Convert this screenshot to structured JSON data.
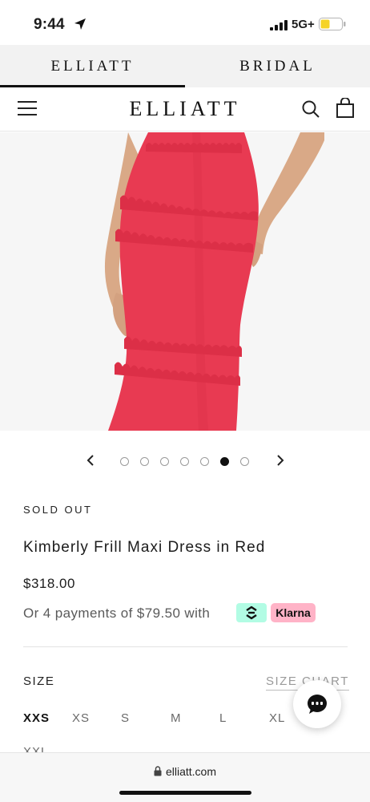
{
  "status_bar": {
    "time": "9:44",
    "network": "5G+",
    "battery_color": "#f5d327"
  },
  "brand_tabs": [
    {
      "label": "ELLIATT",
      "active": true
    },
    {
      "label": "BRIDAL",
      "active": false
    }
  ],
  "header": {
    "logo": "ELLIATT",
    "menu_icon": "hamburger-icon",
    "search_icon": "search-icon",
    "bag_icon": "shopping-bag-icon"
  },
  "product_image": {
    "dress_color": "#e83a52",
    "background": "#f6f6f6"
  },
  "carousel": {
    "total_images": 7,
    "active_index": 5
  },
  "product": {
    "status": "SOLD OUT",
    "title": "Kimberly Frill Maxi Dress in Red",
    "price": "$318.00",
    "installment_text": "Or 4 payments of $79.50 with",
    "klarna_label": "Klarna"
  },
  "sizes": {
    "label": "SIZE",
    "chart_link": "SIZE CHART",
    "options": [
      "XXS",
      "XS",
      "S",
      "M",
      "L",
      "XL",
      "XXL"
    ],
    "selected": "XXS"
  },
  "browser": {
    "url": "elliatt.com"
  },
  "colors": {
    "afterpay": "#b2fce4",
    "klarna": "#ffb3c7",
    "accent": "#111111"
  }
}
